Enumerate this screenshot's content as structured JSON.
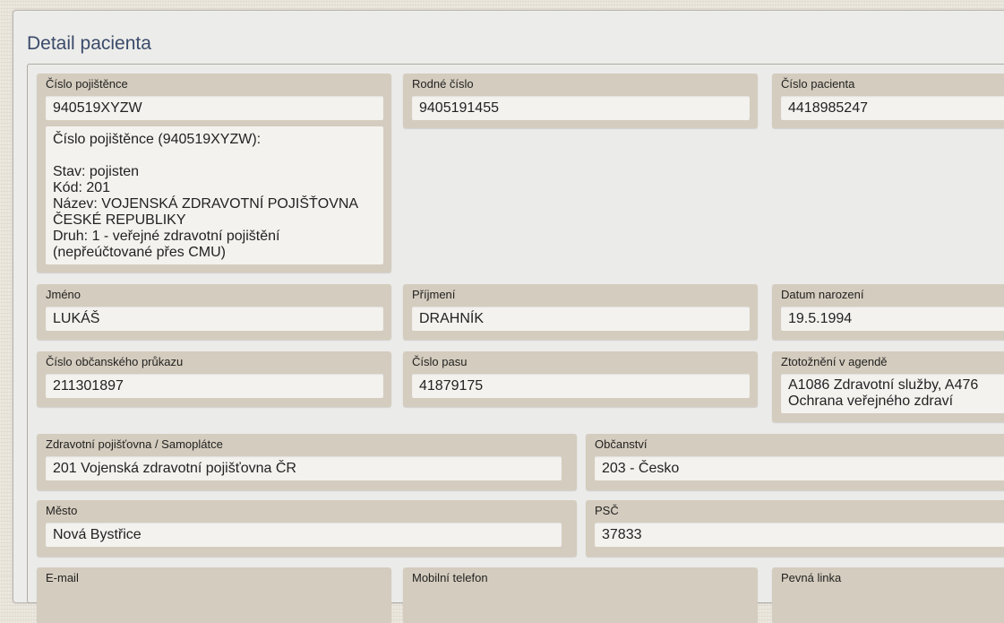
{
  "page": {
    "title": "Detail pacienta"
  },
  "fields": {
    "cislo_pojistence": {
      "label": "Číslo pojištěnce",
      "value": "940519XYZW"
    },
    "rodne_cislo": {
      "label": "Rodné číslo",
      "value": "9405191455"
    },
    "cislo_pacienta": {
      "label": "Číslo pacienta",
      "value": "4418985247"
    },
    "jmeno": {
      "label": "Jméno",
      "value": "LUKÁŠ"
    },
    "prijmeni": {
      "label": "Příjmení",
      "value": "DRAHNÍK"
    },
    "datum_narozeni": {
      "label": "Datum narození",
      "value": "19.5.1994"
    },
    "cislo_op": {
      "label": "Číslo občanského průkazu",
      "value": "211301897"
    },
    "cislo_pasu": {
      "label": "Číslo pasu",
      "value": "41879175"
    },
    "ztotozneni": {
      "label": "Ztotožnění v agendě",
      "value": "A1086 Zdravotní služby, A476 Ochrana veřejného zdraví"
    },
    "pojistovna": {
      "label": "Zdravotní pojišťovna / Samoplátce",
      "value": "201 Vojenská zdravotní pojišťovna ČR"
    },
    "obcanstvi": {
      "label": "Občanství",
      "value": "203 - Česko"
    },
    "mesto": {
      "label": "Město",
      "value": "Nová Bystřice"
    },
    "psc": {
      "label": "PSČ",
      "value": "37833"
    },
    "email": {
      "label": "E-mail"
    },
    "mobil": {
      "label": "Mobilní telefon"
    },
    "pevna": {
      "label": "Pevná linka"
    }
  },
  "insurance_info": {
    "header": "Číslo pojištěnce (940519XYZW):",
    "status": "Stav: pojisten",
    "code": "Kód: 201",
    "name": "Název: VOJENSKÁ ZDRAVOTNÍ POJIŠŤOVNA ČESKÉ REPUBLIKY",
    "type": "Druh: 1 - veřejné zdravotní pojištění (nepřeúčtované přes CMU)"
  }
}
